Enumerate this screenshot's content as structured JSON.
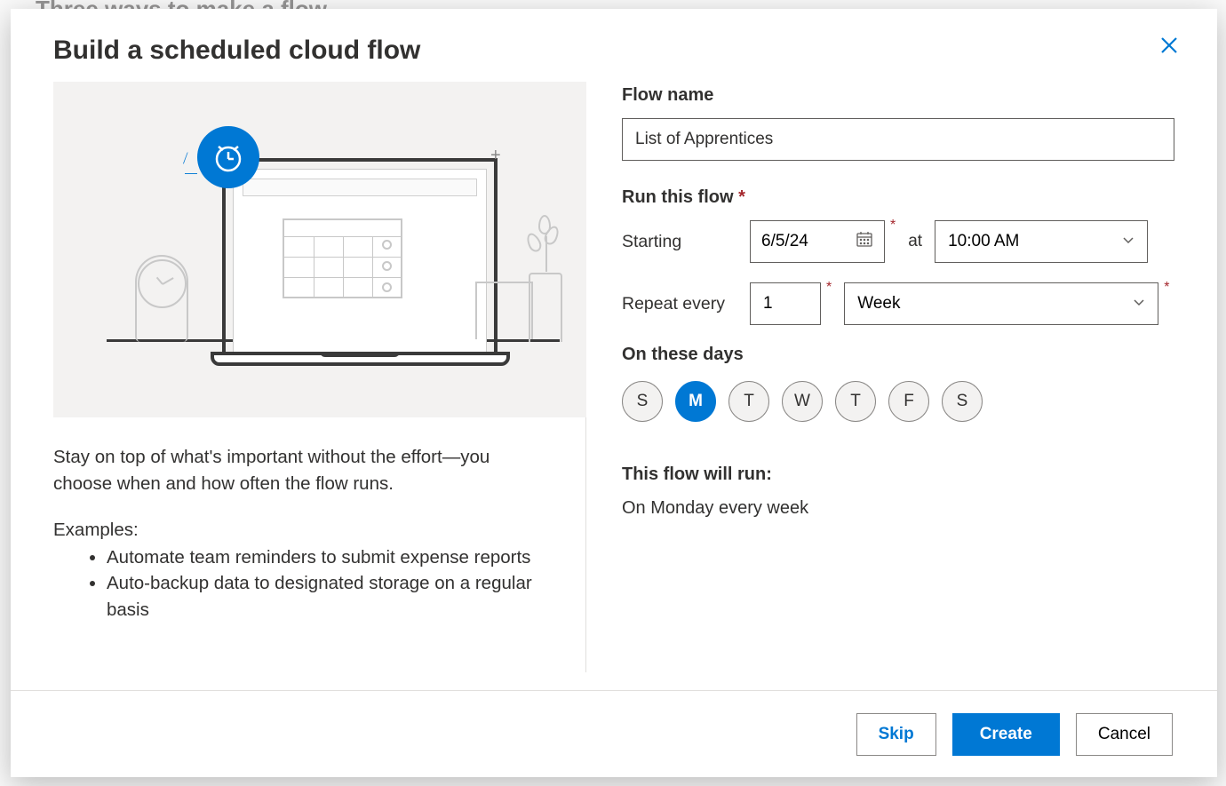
{
  "backdrop_title": "Three ways to make a flow",
  "modal": {
    "title": "Build a scheduled cloud flow",
    "description": "Stay on top of what's important without the effort—you choose when and how often the flow runs.",
    "examples_label": "Examples:",
    "examples": [
      "Automate team reminders to submit expense reports",
      "Auto-backup data to designated storage on a regular basis"
    ]
  },
  "form": {
    "flow_name_label": "Flow name",
    "flow_name_value": "List of Apprentices",
    "run_label": "Run this flow",
    "starting_label": "Starting",
    "starting_date": "6/5/24",
    "at_label": "at",
    "starting_time": "10:00 AM",
    "repeat_label": "Repeat every",
    "repeat_count": "1",
    "repeat_unit": "Week",
    "days_label": "On these days",
    "days": [
      {
        "abbr": "S",
        "selected": false
      },
      {
        "abbr": "M",
        "selected": true
      },
      {
        "abbr": "T",
        "selected": false
      },
      {
        "abbr": "W",
        "selected": false
      },
      {
        "abbr": "T",
        "selected": false
      },
      {
        "abbr": "F",
        "selected": false
      },
      {
        "abbr": "S",
        "selected": false
      }
    ],
    "summary_head": "This flow will run:",
    "summary_text": "On Monday every week"
  },
  "footer": {
    "skip": "Skip",
    "create": "Create",
    "cancel": "Cancel"
  }
}
